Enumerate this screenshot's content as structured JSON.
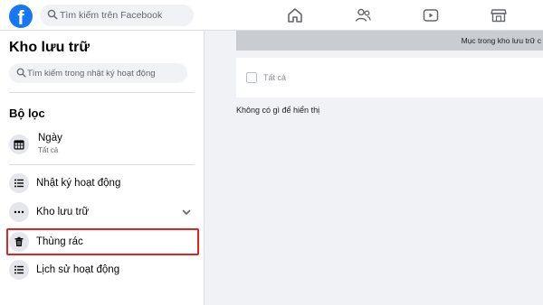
{
  "topbar": {
    "logo_letter": "f",
    "search_placeholder": "Tìm kiếm trên Facebook",
    "nav_icons": [
      "home-icon",
      "friends-icon",
      "watch-icon",
      "marketplace-icon"
    ]
  },
  "sidebar": {
    "title": "Kho lưu trữ",
    "search_placeholder": "Tìm kiếm trong nhật ký hoạt động",
    "filter_title": "Bộ lọc",
    "filter": {
      "label": "Ngày",
      "sub": "Tất cả"
    },
    "items": [
      {
        "label": "Nhật ký hoạt động",
        "icon": "list-icon"
      },
      {
        "label": "Kho lưu trữ",
        "icon": "more-icon"
      },
      {
        "label": "Thùng rác",
        "icon": "trash-icon"
      },
      {
        "label": "Lịch sử hoạt động",
        "icon": "list-icon"
      }
    ]
  },
  "main": {
    "band_text": "Mục trong kho lưu trữ c",
    "select_all": "Tất cả",
    "empty_text": "Không có gì để hiển thị"
  },
  "colors": {
    "brand": "#1877f2",
    "highlight": "#e02424",
    "background": "#f0f2f5"
  }
}
